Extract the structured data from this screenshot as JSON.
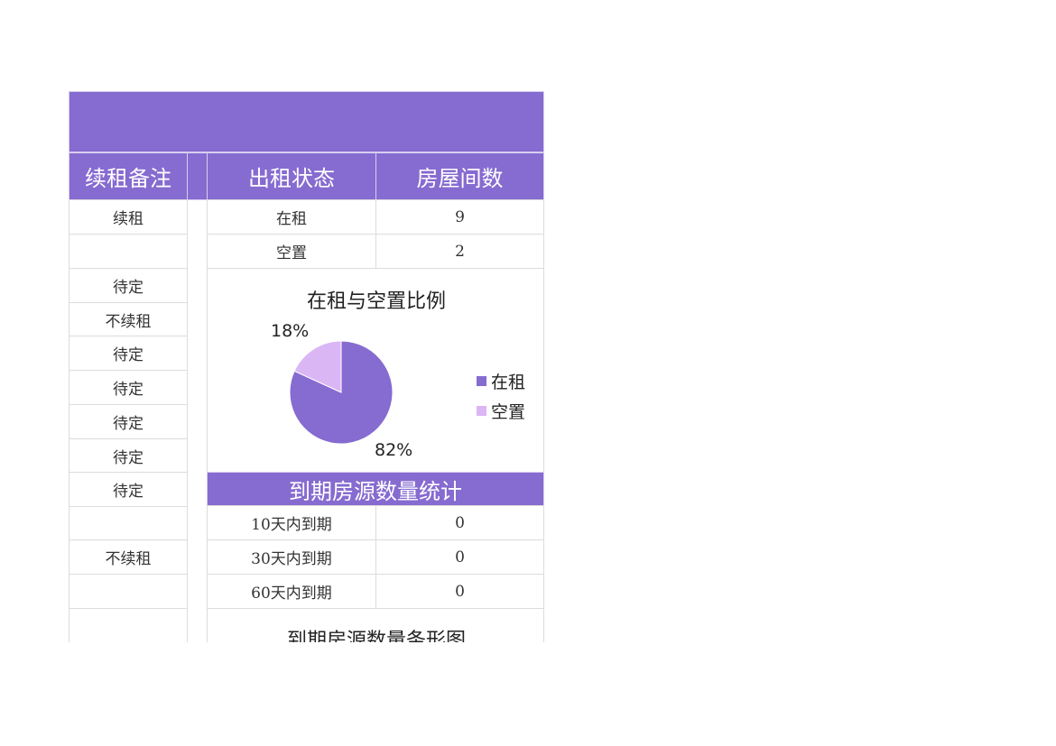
{
  "title_band": {
    "text": ""
  },
  "headers": {
    "renewal_note": "续租备注",
    "rent_status": "出租状态",
    "room_count": "房屋间数"
  },
  "renewal_notes": [
    "续租",
    "",
    "待定",
    "不续租",
    "待定",
    "待定",
    "待定",
    "待定",
    "待定",
    "",
    "不续租",
    "",
    ""
  ],
  "status_table": [
    {
      "status": "在租",
      "count": "9"
    },
    {
      "status": "空置",
      "count": "2"
    }
  ],
  "pie_chart": {
    "title": "在租与空置比例",
    "legend": [
      {
        "label": "在租",
        "color": "#866bd0"
      },
      {
        "label": "空置",
        "color": "#dbb6f5"
      }
    ],
    "labels": [
      "82%",
      "18%"
    ]
  },
  "chart_data": [
    {
      "type": "pie",
      "title": "在租与空置比例",
      "categories": [
        "在租",
        "空置"
      ],
      "values": [
        9,
        2
      ],
      "percent_labels": [
        "82%",
        "18%"
      ],
      "colors": [
        "#866bd0",
        "#dbb6f5"
      ],
      "legend": "right"
    },
    {
      "type": "bar",
      "title": "到期房源数量条形图",
      "categories": [
        "10天内到期",
        "30天内到期",
        "60天内到期"
      ],
      "values": [
        0,
        0,
        0
      ]
    }
  ],
  "expiry_section": {
    "title": "到期房源数量统计",
    "rows": [
      {
        "label": "10天内到期",
        "value": "0"
      },
      {
        "label": "30天内到期",
        "value": "0"
      },
      {
        "label": "60天内到期",
        "value": "0"
      }
    ]
  },
  "bar_chart": {
    "title": "到期房源数量条形图"
  }
}
